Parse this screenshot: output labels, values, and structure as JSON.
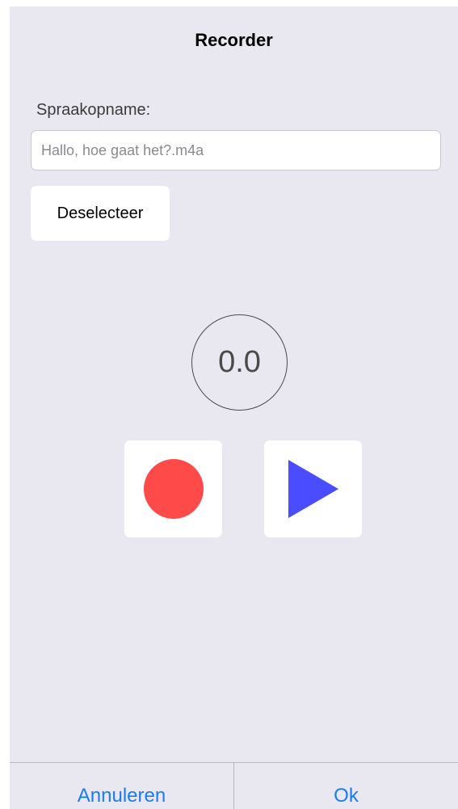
{
  "screen": {
    "title": "Recorder"
  },
  "recording": {
    "field_label": "Spraakopname:",
    "file_name": "",
    "placeholder": "Hallo, hoe gaat het?.m4a"
  },
  "deselect_button": {
    "label": "Deselecteer"
  },
  "timer": {
    "value": "0.0"
  },
  "controls": {
    "record": {
      "icon": "record-icon",
      "color": "#ff4a4a"
    },
    "play": {
      "icon": "play-icon",
      "color": "#4a4cff"
    }
  },
  "bottom_bar": {
    "cancel_label": "Annuleren",
    "ok_label": "Ok",
    "accent_color": "#1a7cf5"
  },
  "colors": {
    "background": "#e9e8f0",
    "surface": "#ffffff"
  }
}
